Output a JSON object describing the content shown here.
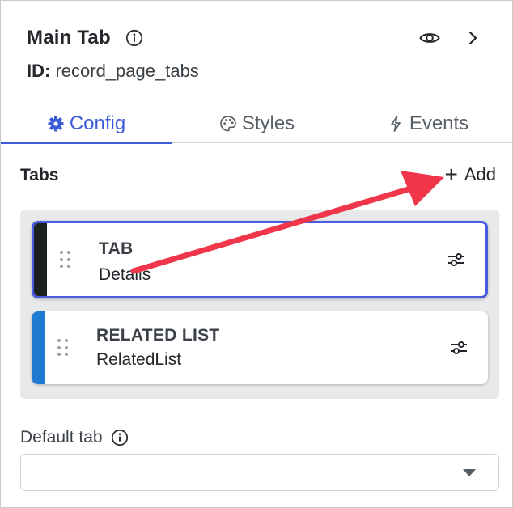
{
  "panel": {
    "title": "Main Tab",
    "id_label": "ID:",
    "id_value": "record_page_tabs"
  },
  "tabs": [
    {
      "label": "Config",
      "icon": "gear-icon",
      "active": true
    },
    {
      "label": "Styles",
      "icon": "palette-icon",
      "active": false
    },
    {
      "label": "Events",
      "icon": "bolt-icon",
      "active": false
    }
  ],
  "tabs_section": {
    "title": "Tabs",
    "add_label": "Add",
    "items": [
      {
        "type": "TAB",
        "name": "Details",
        "stripe_color": "#1b1f1d",
        "selected": true
      },
      {
        "type": "RELATED LIST",
        "name": "RelatedList",
        "stripe_color": "#1f7ad1",
        "selected": false
      }
    ]
  },
  "default_tab": {
    "label": "Default tab",
    "value": ""
  },
  "colors": {
    "accent": "#3c5bd6",
    "annotation_arrow": "#f0364a"
  }
}
